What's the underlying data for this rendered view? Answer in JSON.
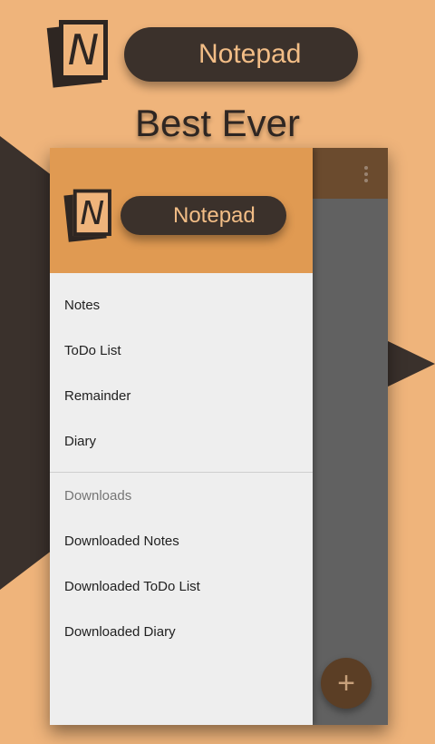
{
  "promo": {
    "app_name": "Notepad",
    "tagline": "Best Ever",
    "logo_letter": "N"
  },
  "app": {
    "drawer_header": {
      "logo_letter": "N",
      "app_name": "Notepad"
    },
    "drawer_items": [
      {
        "label": "Notes"
      },
      {
        "label": "ToDo List"
      },
      {
        "label": "Remainder"
      },
      {
        "label": "Diary"
      }
    ],
    "downloads_section": {
      "header": "Downloads",
      "items": [
        {
          "label": "Downloaded Notes"
        },
        {
          "label": "Downloaded ToDo List"
        },
        {
          "label": "Downloaded Diary"
        }
      ]
    },
    "fab_symbol": "+",
    "icons": {
      "overflow": "overflow-menu-icon",
      "add": "plus-icon"
    }
  },
  "colors": {
    "background": "#EFB47B",
    "dark_brown": "#3B312B",
    "drawer_header": "#E09A52",
    "app_bar": "#6B4B2E",
    "fab": "#5B3E25"
  }
}
